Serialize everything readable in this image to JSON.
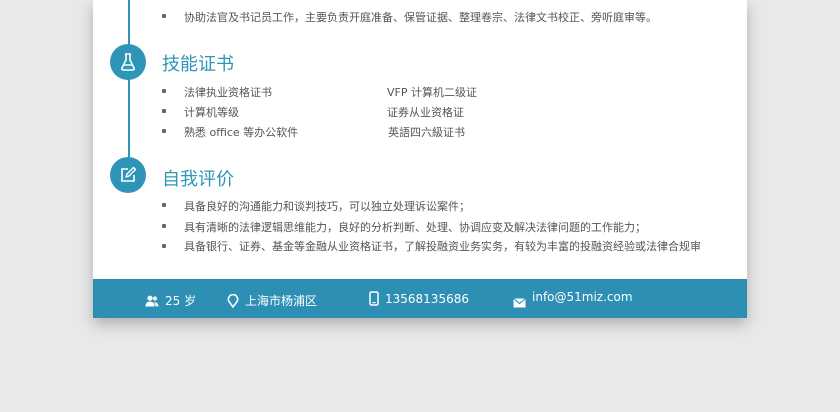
{
  "experience": {
    "item": "协助法官及书记员工作，主要负责开庭准备、保管证据、整理卷宗、法律文书校正、旁听庭审等。"
  },
  "skills": {
    "title": "技能证书",
    "left": [
      "法律执业资格证书",
      "计算机等级",
      "熟悉 office 等办公软件"
    ],
    "right": [
      "VFP 计算机二级证",
      "证券从业资格证",
      "英語四六級证书"
    ]
  },
  "evaluation": {
    "title": "自我评价",
    "items": [
      "具备良好的沟通能力和谈判技巧，可以独立处理诉讼案件；",
      "具有清晰的法律逻辑思维能力，良好的分析判断、处理、协调应变及解决法律问题的工作能力；",
      "具备银行、证券、基金等金融从业资格证书，了解投融资业务实务，有较为丰富的投融资经验或法律合规审"
    ]
  },
  "footer": {
    "age": "25 岁",
    "location": "上海市杨浦区",
    "phone": "13568135686",
    "email": "info@51miz.com"
  },
  "colors": {
    "accent": "#2e95b8",
    "footer": "#2e8fb5"
  },
  "icons": [
    "flask-icon",
    "edit-icon",
    "user-group-icon",
    "location-pin-icon",
    "phone-icon",
    "mail-icon"
  ]
}
